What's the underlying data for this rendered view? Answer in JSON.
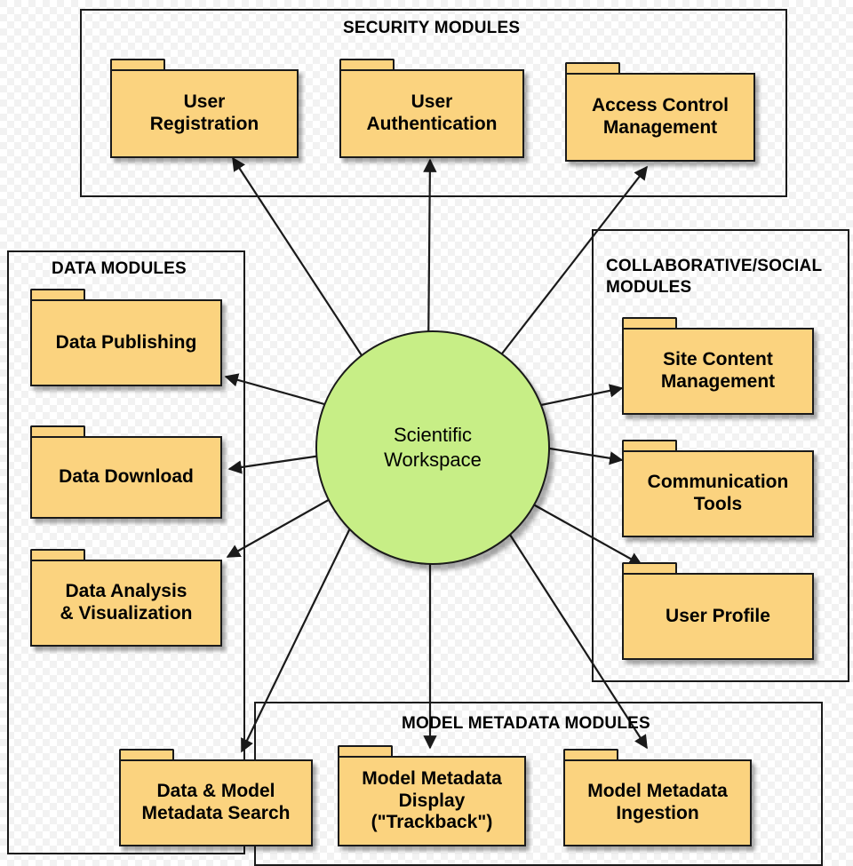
{
  "diagram": {
    "hub": {
      "label": "Scientific\nWorkspace",
      "color": "#c7ee86"
    },
    "groups": [
      {
        "id": "security",
        "title": "SECURITY MODULES"
      },
      {
        "id": "data",
        "title": "DATA MODULES"
      },
      {
        "id": "collaborative",
        "title": "COLLABORATIVE/SOCIAL\nMODULES"
      },
      {
        "id": "model-metadata",
        "title": "MODEL METADATA MODULES"
      }
    ],
    "nodes": [
      {
        "id": "user-registration",
        "label": "User\nRegistration",
        "group": "security"
      },
      {
        "id": "user-authentication",
        "label": "User\nAuthentication",
        "group": "security"
      },
      {
        "id": "access-control-management",
        "label": "Access Control\nManagement",
        "group": "security"
      },
      {
        "id": "data-publishing",
        "label": "Data Publishing",
        "group": "data"
      },
      {
        "id": "data-download",
        "label": "Data Download",
        "group": "data"
      },
      {
        "id": "data-analysis-visualization",
        "label": "Data Analysis\n& Visualization",
        "group": "data"
      },
      {
        "id": "site-content-management",
        "label": "Site Content\nManagement",
        "group": "collaborative"
      },
      {
        "id": "communication-tools",
        "label": "Communication\nTools",
        "group": "collaborative"
      },
      {
        "id": "user-profile",
        "label": "User Profile",
        "group": "collaborative"
      },
      {
        "id": "data-model-metadata-search",
        "label": "Data & Model\nMetadata Search",
        "group": "model-metadata"
      },
      {
        "id": "model-metadata-display",
        "label": "Model Metadata\nDisplay\n(\"Trackback\")",
        "group": "model-metadata"
      },
      {
        "id": "model-metadata-ingestion",
        "label": "Model Metadata\nIngestion",
        "group": "model-metadata"
      }
    ],
    "colors": {
      "folder_fill": "#fbd37f",
      "stroke": "#1a1a1a",
      "hub_fill": "#c7ee86"
    }
  }
}
